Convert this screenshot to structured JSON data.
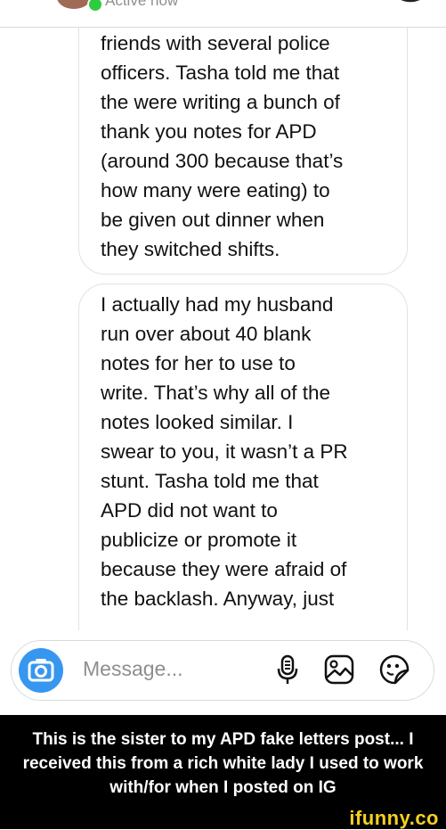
{
  "header": {
    "status": "Active now"
  },
  "messages": [
    {
      "text": "friends with several police\nofficers. Tasha told me that\nthe were writing a bunch of\nthank you notes for APD\n(around 300 because that’s\nhow many were eating) to\nbe given out dinner when\nthey switched shifts."
    },
    {
      "text": "I actually had my husband\nrun over about 40 blank\nnotes for her to use to\nwrite. That’s why all of the\nnotes looked similar. I\nswear to you, it wasn’t a PR\nstunt. Tasha told me that\nAPD did not want to\npublicize or promote it\nbecause they were afraid of\nthe backlash. Anyway, just"
    }
  ],
  "composer": {
    "placeholder": "Message...",
    "icons": [
      "camera-icon",
      "microphone-icon",
      "image-icon",
      "sticker-icon"
    ]
  },
  "caption": "This is the sister to my APD fake letters post... I received this from a rich white lady I used to work with/for when I posted on IG",
  "watermark": "ifunny.co",
  "colors": {
    "accent": "#3797f0",
    "online": "#2ecc40",
    "watermark": "#f4d021"
  }
}
